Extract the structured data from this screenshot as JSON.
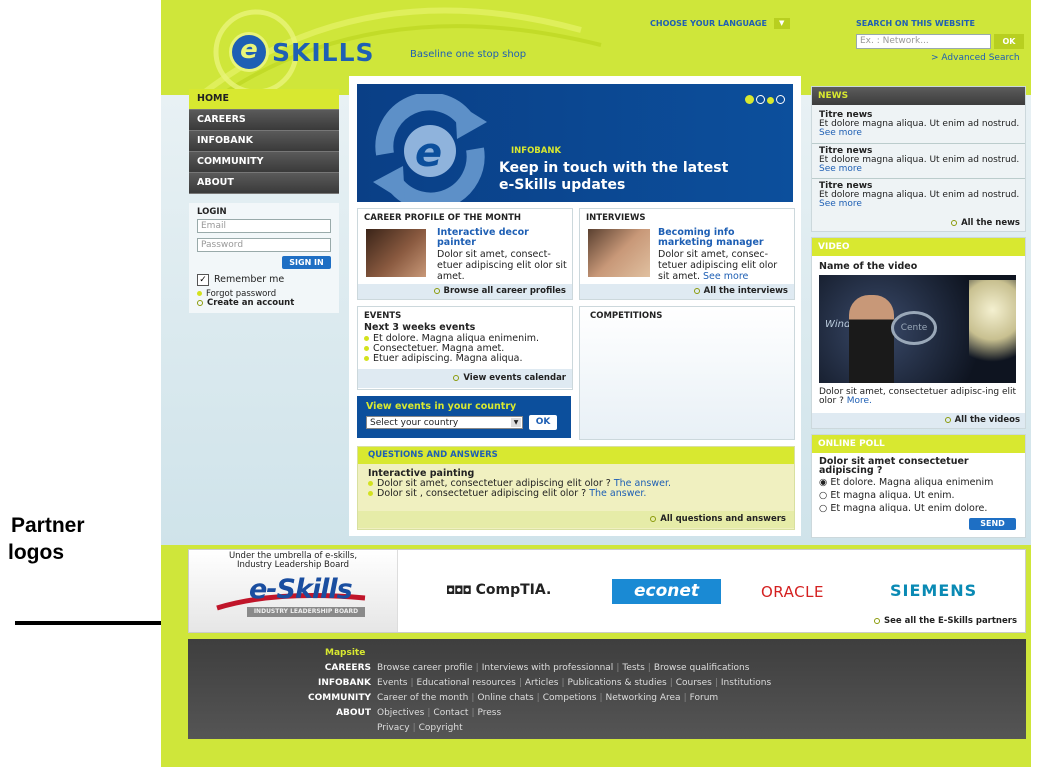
{
  "annotation": {
    "label_line1": "Partner",
    "label_line2": "logos"
  },
  "header": {
    "logo_text": "SKILLS",
    "logo_letter": "e",
    "tagline": "Baseline one stop shop",
    "language_label": "CHOOSE YOUR LANGUAGE",
    "search_label": "SEARCH ON THIS WEBSITE",
    "search_placeholder": "Ex. : Network...",
    "search_button": "OK",
    "advanced_search": "> Advanced Search"
  },
  "nav": {
    "items": [
      "HOME",
      "CAREERS",
      "INFOBANK",
      "COMMUNITY",
      "ABOUT"
    ]
  },
  "login": {
    "title": "LOGIN",
    "email_placeholder": "Email",
    "password_placeholder": "Password",
    "sign_in": "SIGN IN",
    "remember": "Remember me",
    "forgot": "Forgot password",
    "create": "Create an account"
  },
  "hero": {
    "kicker": "INFOBANK",
    "headline1": "Keep in touch with the latest",
    "headline2": "e-Skills updates"
  },
  "career": {
    "title": "CAREER PROFILE OF THE MONTH",
    "link1": "Interactive decor",
    "link2": "painter",
    "text": "Dolor sit amet, consect-etuer adipiscing elit olor sit amet.",
    "footer": "Browse all career profiles"
  },
  "interviews": {
    "title": "INTERVIEWS",
    "link1": "Becoming info",
    "link2": "marketing manager",
    "text": "Dolor sit amet, consec-tetuer adipiscing elit olor sit amet.",
    "see_more": "See more",
    "footer": "All the interviews"
  },
  "events": {
    "title": "EVENTS",
    "subtitle": "Next 3 weeks events",
    "items": [
      "Et dolore. Magna aliqua enimenim.",
      "Consectetuer. Magna amet.",
      "Etuer adipiscing. Magna aliqua."
    ],
    "footer": "View events calendar"
  },
  "competitions": {
    "title": "COMPETITIONS"
  },
  "country": {
    "title": "View events in your country",
    "select": "Select your country",
    "button": "OK"
  },
  "qa": {
    "title": "QUESTIONS AND ANSWERS",
    "subtitle": "Interactive painting",
    "items": [
      "Dolor sit amet, consectetuer adipiscing elit olor ?",
      "Dolor sit , consectetuer adipiscing elit olor ?"
    ],
    "answer": "The answer.",
    "footer": "All questions and answers"
  },
  "news": {
    "title": "NEWS",
    "items": [
      {
        "title": "Titre news",
        "text": "Et dolore magna aliqua. Ut enim ad nostrud.",
        "more": "See more"
      },
      {
        "title": "Titre news",
        "text": "Et dolore magna aliqua. Ut enim ad nostrud.",
        "more": "See more"
      },
      {
        "title": "Titre news",
        "text": "Et dolore magna aliqua. Ut enim ad nostrud.",
        "more": "See more"
      }
    ],
    "footer": "All the news"
  },
  "video": {
    "title": "VIDEO",
    "name": "Name of the video",
    "caption": "Dolor sit amet, consectetuer adipisc-ing elit olor ?",
    "more": "More.",
    "footer": "All the videos",
    "screen_text1": "Windo",
    "screen_text2": "Cente"
  },
  "poll": {
    "title": "ONLINE POLL",
    "question": "Dolor sit amet consectetuer adipiscing ?",
    "options": [
      "Et dolore. Magna aliqua enimenim",
      "Et magna aliqua. Ut enim.",
      "Et magna aliqua. Ut enim dolore."
    ],
    "selected": 0,
    "send": "SEND"
  },
  "partners": {
    "umbrella_line1": "Under the umbrella of e-skills,",
    "umbrella_line2": "Industry Leadership Board",
    "eskills_logo": "e-Skills",
    "eskills_sub": "INDUSTRY LEADERSHIP BOARD",
    "logos": [
      "CompTIA.",
      "econet",
      "ORACLE",
      "SIEMENS"
    ],
    "see_all": "See all the E-Skills partners"
  },
  "footer": {
    "mapsite": "Mapsite",
    "rows": [
      {
        "key": "CAREERS",
        "links": [
          "Browse career profile",
          "Interviews with professionnal",
          "Tests",
          "Browse qualifications"
        ]
      },
      {
        "key": "INFOBANK",
        "links": [
          "Events",
          "Educational resources",
          "Articles",
          "Publications & studies",
          "Courses",
          "Institutions"
        ]
      },
      {
        "key": "COMMUNITY",
        "links": [
          "Career of the month",
          "Online chats",
          "Competions",
          "Networking Area",
          "Forum"
        ]
      },
      {
        "key": "ABOUT",
        "links": [
          "Objectives",
          "Contact",
          "Press"
        ]
      },
      {
        "key": "",
        "links": [
          "Privacy",
          "Copyright"
        ]
      }
    ]
  },
  "colors": {
    "lime": "#cfe63a",
    "accent": "#d8e830",
    "blue": "#1e5fb4",
    "hero": "#0c4a94",
    "dark": "#3c3c3c"
  }
}
